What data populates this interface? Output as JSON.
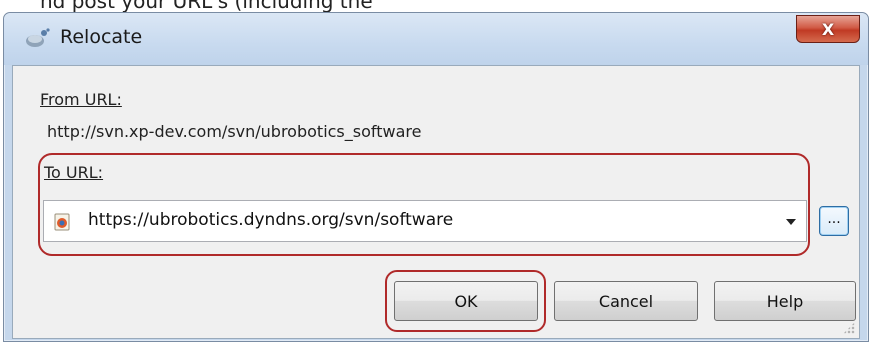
{
  "background": {
    "cropped_text": "nd post your URL's (including the "
  },
  "window": {
    "title": "Relocate",
    "close_glyph": "X",
    "accent_close_color": "#c03a24"
  },
  "form": {
    "from_label": "From URL:",
    "from_value": "http://svn.xp-dev.com/svn/ubrobotics_software",
    "to_label": "To URL:",
    "to_value": "https://ubrobotics.dyndns.org/svn/software",
    "browse_label": "..."
  },
  "buttons": {
    "ok": "OK",
    "cancel": "Cancel",
    "help": "Help"
  },
  "highlight_color": "#b02a2a",
  "icons": {
    "app": "relocate-app-icon",
    "url": "repository-url-icon",
    "dropdown": "chevron-down-icon"
  }
}
